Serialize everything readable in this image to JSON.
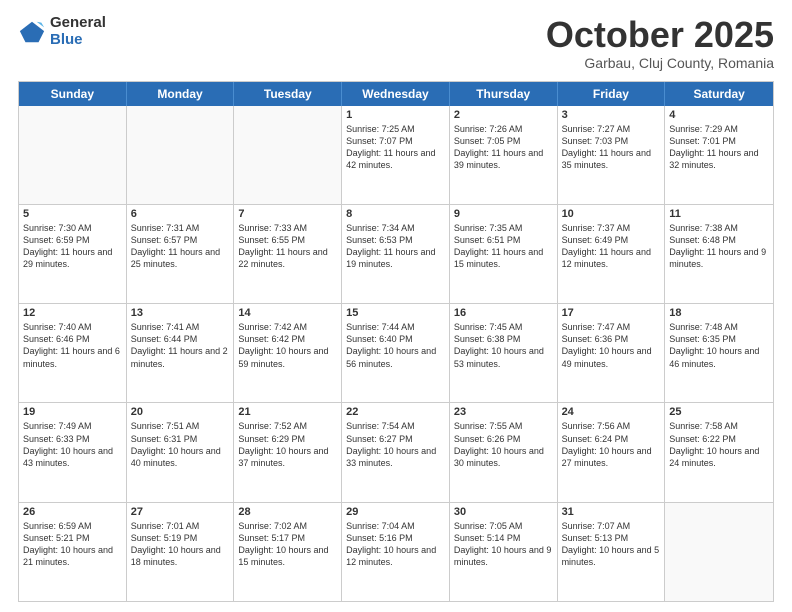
{
  "logo": {
    "general": "General",
    "blue": "Blue"
  },
  "header": {
    "month": "October 2025",
    "location": "Garbau, Cluj County, Romania"
  },
  "days_of_week": [
    "Sunday",
    "Monday",
    "Tuesday",
    "Wednesday",
    "Thursday",
    "Friday",
    "Saturday"
  ],
  "weeks": [
    [
      {
        "day": "",
        "empty": true
      },
      {
        "day": "",
        "empty": true
      },
      {
        "day": "",
        "empty": true
      },
      {
        "day": "1",
        "sunrise": "7:25 AM",
        "sunset": "7:07 PM",
        "daylight": "11 hours and 42 minutes."
      },
      {
        "day": "2",
        "sunrise": "7:26 AM",
        "sunset": "7:05 PM",
        "daylight": "11 hours and 39 minutes."
      },
      {
        "day": "3",
        "sunrise": "7:27 AM",
        "sunset": "7:03 PM",
        "daylight": "11 hours and 35 minutes."
      },
      {
        "day": "4",
        "sunrise": "7:29 AM",
        "sunset": "7:01 PM",
        "daylight": "11 hours and 32 minutes."
      }
    ],
    [
      {
        "day": "5",
        "sunrise": "7:30 AM",
        "sunset": "6:59 PM",
        "daylight": "11 hours and 29 minutes."
      },
      {
        "day": "6",
        "sunrise": "7:31 AM",
        "sunset": "6:57 PM",
        "daylight": "11 hours and 25 minutes."
      },
      {
        "day": "7",
        "sunrise": "7:33 AM",
        "sunset": "6:55 PM",
        "daylight": "11 hours and 22 minutes."
      },
      {
        "day": "8",
        "sunrise": "7:34 AM",
        "sunset": "6:53 PM",
        "daylight": "11 hours and 19 minutes."
      },
      {
        "day": "9",
        "sunrise": "7:35 AM",
        "sunset": "6:51 PM",
        "daylight": "11 hours and 15 minutes."
      },
      {
        "day": "10",
        "sunrise": "7:37 AM",
        "sunset": "6:49 PM",
        "daylight": "11 hours and 12 minutes."
      },
      {
        "day": "11",
        "sunrise": "7:38 AM",
        "sunset": "6:48 PM",
        "daylight": "11 hours and 9 minutes."
      }
    ],
    [
      {
        "day": "12",
        "sunrise": "7:40 AM",
        "sunset": "6:46 PM",
        "daylight": "11 hours and 6 minutes."
      },
      {
        "day": "13",
        "sunrise": "7:41 AM",
        "sunset": "6:44 PM",
        "daylight": "11 hours and 2 minutes."
      },
      {
        "day": "14",
        "sunrise": "7:42 AM",
        "sunset": "6:42 PM",
        "daylight": "10 hours and 59 minutes."
      },
      {
        "day": "15",
        "sunrise": "7:44 AM",
        "sunset": "6:40 PM",
        "daylight": "10 hours and 56 minutes."
      },
      {
        "day": "16",
        "sunrise": "7:45 AM",
        "sunset": "6:38 PM",
        "daylight": "10 hours and 53 minutes."
      },
      {
        "day": "17",
        "sunrise": "7:47 AM",
        "sunset": "6:36 PM",
        "daylight": "10 hours and 49 minutes."
      },
      {
        "day": "18",
        "sunrise": "7:48 AM",
        "sunset": "6:35 PM",
        "daylight": "10 hours and 46 minutes."
      }
    ],
    [
      {
        "day": "19",
        "sunrise": "7:49 AM",
        "sunset": "6:33 PM",
        "daylight": "10 hours and 43 minutes."
      },
      {
        "day": "20",
        "sunrise": "7:51 AM",
        "sunset": "6:31 PM",
        "daylight": "10 hours and 40 minutes."
      },
      {
        "day": "21",
        "sunrise": "7:52 AM",
        "sunset": "6:29 PM",
        "daylight": "10 hours and 37 minutes."
      },
      {
        "day": "22",
        "sunrise": "7:54 AM",
        "sunset": "6:27 PM",
        "daylight": "10 hours and 33 minutes."
      },
      {
        "day": "23",
        "sunrise": "7:55 AM",
        "sunset": "6:26 PM",
        "daylight": "10 hours and 30 minutes."
      },
      {
        "day": "24",
        "sunrise": "7:56 AM",
        "sunset": "6:24 PM",
        "daylight": "10 hours and 27 minutes."
      },
      {
        "day": "25",
        "sunrise": "7:58 AM",
        "sunset": "6:22 PM",
        "daylight": "10 hours and 24 minutes."
      }
    ],
    [
      {
        "day": "26",
        "sunrise": "6:59 AM",
        "sunset": "5:21 PM",
        "daylight": "10 hours and 21 minutes."
      },
      {
        "day": "27",
        "sunrise": "7:01 AM",
        "sunset": "5:19 PM",
        "daylight": "10 hours and 18 minutes."
      },
      {
        "day": "28",
        "sunrise": "7:02 AM",
        "sunset": "5:17 PM",
        "daylight": "10 hours and 15 minutes."
      },
      {
        "day": "29",
        "sunrise": "7:04 AM",
        "sunset": "5:16 PM",
        "daylight": "10 hours and 12 minutes."
      },
      {
        "day": "30",
        "sunrise": "7:05 AM",
        "sunset": "5:14 PM",
        "daylight": "10 hours and 9 minutes."
      },
      {
        "day": "31",
        "sunrise": "7:07 AM",
        "sunset": "5:13 PM",
        "daylight": "10 hours and 5 minutes."
      },
      {
        "day": "",
        "empty": true
      }
    ]
  ],
  "labels": {
    "sunrise": "Sunrise:",
    "sunset": "Sunset:",
    "daylight": "Daylight:"
  }
}
